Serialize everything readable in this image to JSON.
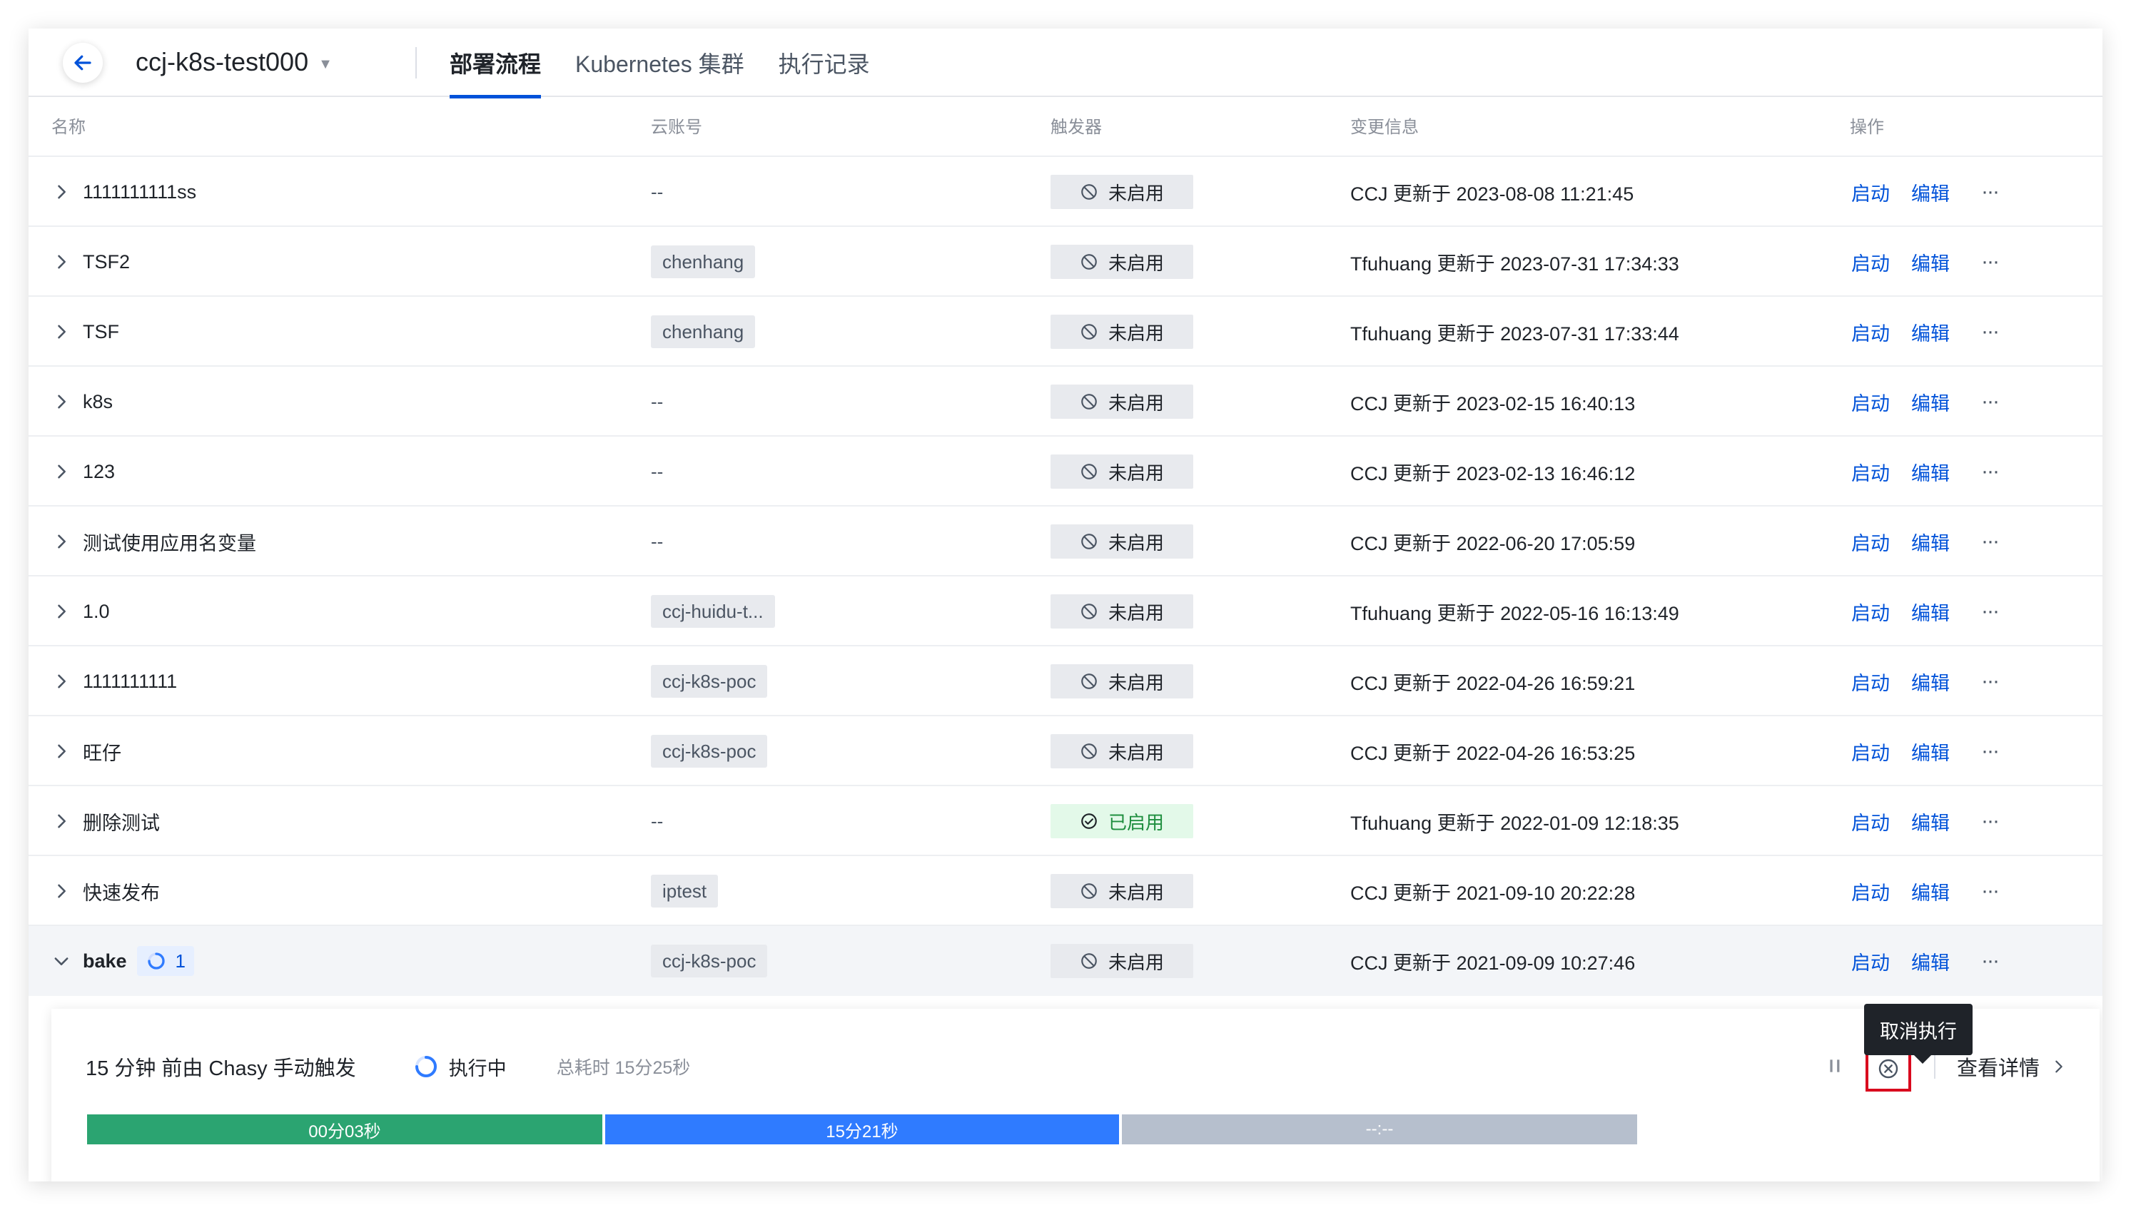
{
  "header": {
    "project_name": "ccj-k8s-test000",
    "tabs": [
      {
        "label": "部署流程",
        "active": true
      },
      {
        "label": "Kubernetes 集群",
        "active": false
      },
      {
        "label": "执行记录",
        "active": false
      }
    ]
  },
  "table": {
    "columns": {
      "name": "名称",
      "account": "云账号",
      "trigger": "触发器",
      "change": "变更信息",
      "ops": "操作"
    },
    "rows": [
      {
        "name": "1111111111ss",
        "account": "--",
        "trigger": "未启用",
        "change": "CCJ 更新于 2023-08-08 11:21:45",
        "start": "启动",
        "edit": "编辑"
      },
      {
        "name": "TSF2",
        "account": "chenhang",
        "trigger": "未启用",
        "change": "Tfuhuang 更新于 2023-07-31 17:34:33",
        "start": "启动",
        "edit": "编辑"
      },
      {
        "name": "TSF",
        "account": "chenhang",
        "trigger": "未启用",
        "change": "Tfuhuang 更新于 2023-07-31 17:33:44",
        "start": "启动",
        "edit": "编辑"
      },
      {
        "name": "k8s",
        "account": "--",
        "trigger": "未启用",
        "change": "CCJ 更新于 2023-02-15 16:40:13",
        "start": "启动",
        "edit": "编辑"
      },
      {
        "name": "123",
        "account": "--",
        "trigger": "未启用",
        "change": "CCJ 更新于 2023-02-13 16:46:12",
        "start": "启动",
        "edit": "编辑"
      },
      {
        "name": "测试使用应用名变量",
        "account": "--",
        "trigger": "未启用",
        "change": "CCJ 更新于 2022-06-20 17:05:59",
        "start": "启动",
        "edit": "编辑"
      },
      {
        "name": "1.0",
        "account": "ccj-huidu-t...",
        "trigger": "未启用",
        "change": "Tfuhuang 更新于 2022-05-16 16:13:49",
        "start": "启动",
        "edit": "编辑"
      },
      {
        "name": "1111111111",
        "account": "ccj-k8s-poc",
        "trigger": "未启用",
        "change": "CCJ 更新于 2022-04-26 16:59:21",
        "start": "启动",
        "edit": "编辑"
      },
      {
        "name": "旺仔",
        "account": "ccj-k8s-poc",
        "trigger": "未启用",
        "change": "CCJ 更新于 2022-04-26 16:53:25",
        "start": "启动",
        "edit": "编辑"
      },
      {
        "name": "删除测试",
        "account": "--",
        "trigger": "已启用",
        "change": "Tfuhuang 更新于 2022-01-09 12:18:35",
        "start": "启动",
        "edit": "编辑"
      },
      {
        "name": "快速发布",
        "account": "iptest",
        "trigger": "未启用",
        "change": "CCJ 更新于 2021-09-10 20:22:28",
        "start": "启动",
        "edit": "编辑"
      },
      {
        "name": "bake",
        "account": "ccj-k8s-poc",
        "trigger": "未启用",
        "change": "CCJ 更新于 2021-09-09 10:27:46",
        "start": "启动",
        "edit": "编辑",
        "running_count": "1"
      }
    ]
  },
  "execution": {
    "summary": "15 分钟 前由 Chasy 手动触发",
    "status": "执行中",
    "total_time": "总耗时 15分25秒",
    "detail_link": "查看详情",
    "tooltip": "取消执行",
    "stages": [
      "00分03秒",
      "15分21秒",
      "--:--"
    ]
  },
  "colors": {
    "accent": "#0052d9",
    "success": "#2ba471",
    "running": "#2f7bff",
    "pending": "#b6bfcd",
    "danger": "#d90a1e"
  }
}
